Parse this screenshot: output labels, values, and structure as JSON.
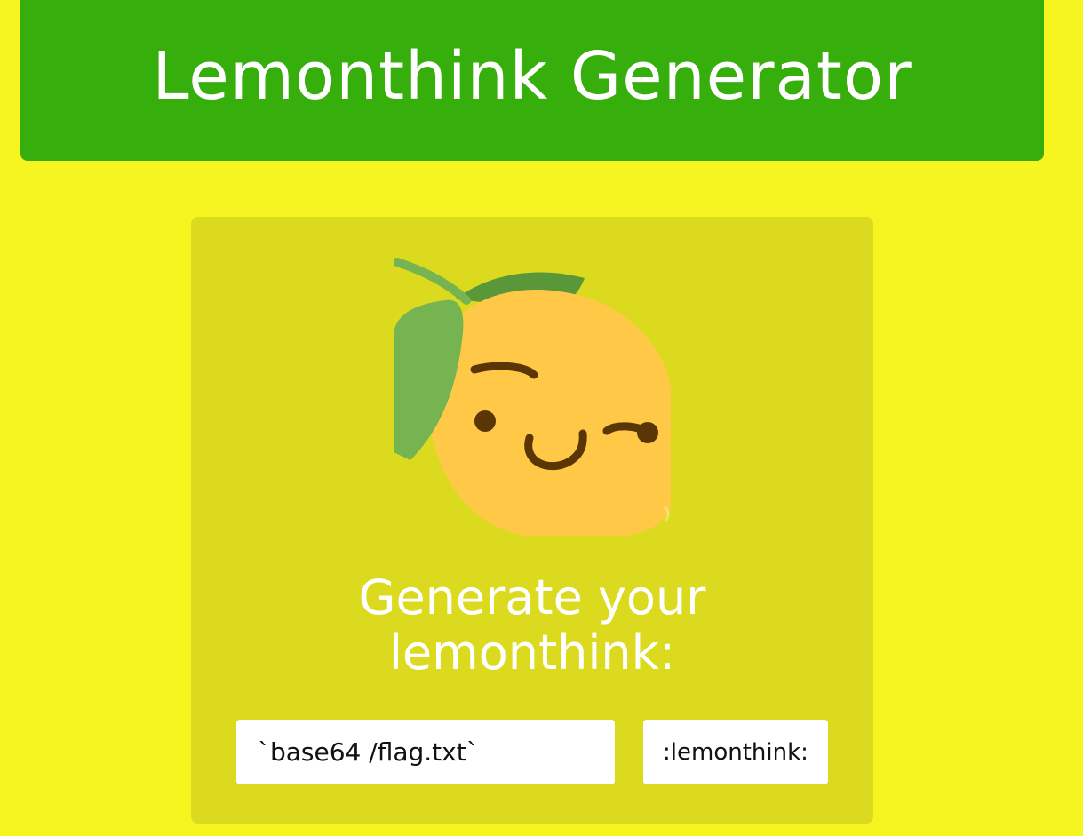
{
  "header": {
    "title": "Lemonthink Generator"
  },
  "main": {
    "image": {
      "icon": "lemonthink-lemon-icon"
    },
    "prompt": "Generate your lemonthink:",
    "input": {
      "value": "`base64 /flag.txt`"
    },
    "button": {
      "label": ":lemonthink:"
    }
  },
  "colors": {
    "page_background": "#f7f51f",
    "header_background": "#36ae0c",
    "card_background": "#dcda1f",
    "lemon": "#ffc947",
    "leaf": "#76b351",
    "leaf_dark": "#5a9739",
    "face": "#5a3506"
  }
}
